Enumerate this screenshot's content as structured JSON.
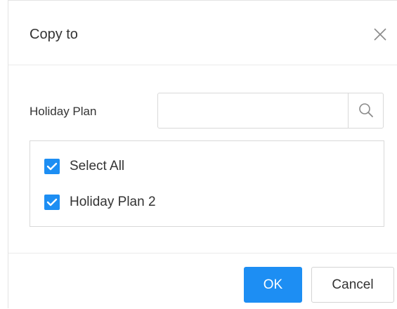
{
  "dialog": {
    "title": "Copy to",
    "close_icon": "close-icon"
  },
  "search": {
    "label": "Holiday Plan",
    "value": "",
    "placeholder": "",
    "icon": "search-icon"
  },
  "list": {
    "items": [
      {
        "label": "Select All",
        "checked": true
      },
      {
        "label": "Holiday Plan 2",
        "checked": true
      }
    ]
  },
  "footer": {
    "ok_label": "OK",
    "cancel_label": "Cancel"
  },
  "colors": {
    "accent": "#1d8ef3",
    "text": "#333333",
    "border": "#d9d9d9"
  }
}
